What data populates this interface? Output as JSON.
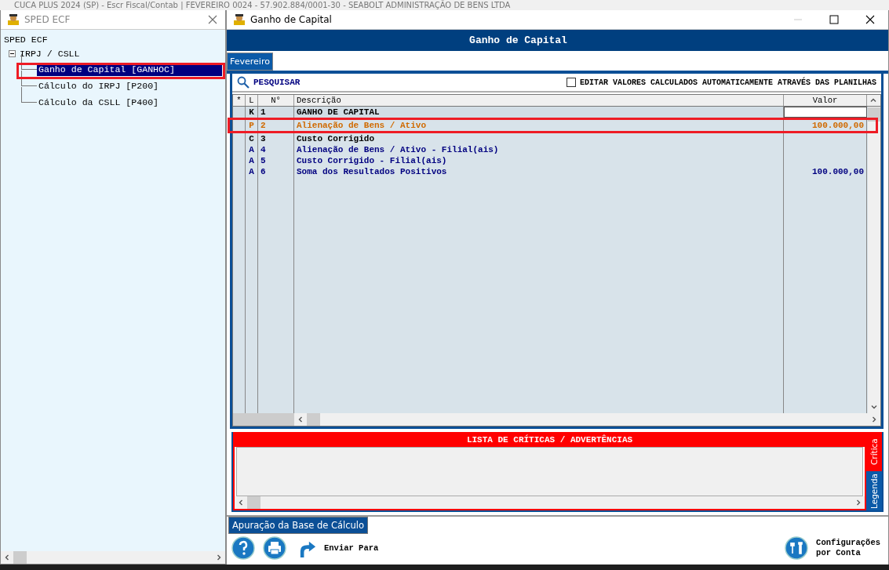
{
  "background_title": "CUCA PLUS 2024 (SP) - Escr Fiscal/Contab | FEVEREIRO 0024 - 57.902.884/0001-30 - SEABOLT ADMINISTRAÇÃO DE BENS LTDA",
  "tree_window": {
    "title": "SPED ECF",
    "root": "SPED ECF",
    "nodes": [
      {
        "label": "IRPJ / CSLL",
        "expanded": true,
        "children": [
          {
            "label": "Ganho de Capital [GANHOC]",
            "selected": true
          },
          {
            "label": "Cálculo do IRPJ [P200]",
            "selected": false
          },
          {
            "label": "Cálculo da CSLL [P400]",
            "selected": false
          }
        ]
      }
    ]
  },
  "main_window": {
    "title": "Ganho de Capital",
    "header": "Ganho de Capital",
    "tabs": [
      {
        "label": "Fevereiro",
        "selected": true
      }
    ],
    "search_label": "PESQUISAR",
    "edit_option": {
      "label": "EDITAR VALORES CALCULADOS AUTOMATICAMENTE ATRAVÉS DAS PLANILHAS",
      "checked": false
    },
    "table": {
      "columns": [
        "*",
        "L",
        "N°",
        "Descrição",
        "Valor"
      ],
      "rows": [
        {
          "kind": "title",
          "l": "K",
          "n": "1",
          "description": "GANHO DE CAPITAL",
          "value": "",
          "editing": true
        },
        {
          "kind": "input",
          "l": "P",
          "n": "2",
          "description": "Alienação de Bens / Ativo",
          "value": "100.000,00",
          "editing": false
        },
        {
          "kind": "plain",
          "l": "C",
          "n": "3",
          "description": "Custo Corrigido",
          "value": "",
          "editing": false
        },
        {
          "kind": "auto",
          "l": "A",
          "n": "4",
          "description": "Alienação de Bens / Ativo - Filial(ais)",
          "value": "",
          "editing": false
        },
        {
          "kind": "auto",
          "l": "A",
          "n": "5",
          "description": "Custo Corrigido - Filial(ais)",
          "value": "",
          "editing": false
        },
        {
          "kind": "auto",
          "l": "A",
          "n": "6",
          "description": "Soma dos Resultados Positivos",
          "value": "100.000,00",
          "editing": false
        }
      ]
    },
    "critics": {
      "title": "LISTA DE CRÍTICAS / ADVERTÊNCIAS",
      "side_tabs": [
        {
          "label": "Crítica",
          "selected": true
        },
        {
          "label": "Legenda",
          "selected": false
        }
      ]
    },
    "bottom_tabs": [
      {
        "label": "Apuração da Base de Cálculo",
        "selected": true
      }
    ],
    "footer": {
      "send_label": "Enviar Para",
      "settings_label": "Configurações\npor Conta"
    }
  }
}
